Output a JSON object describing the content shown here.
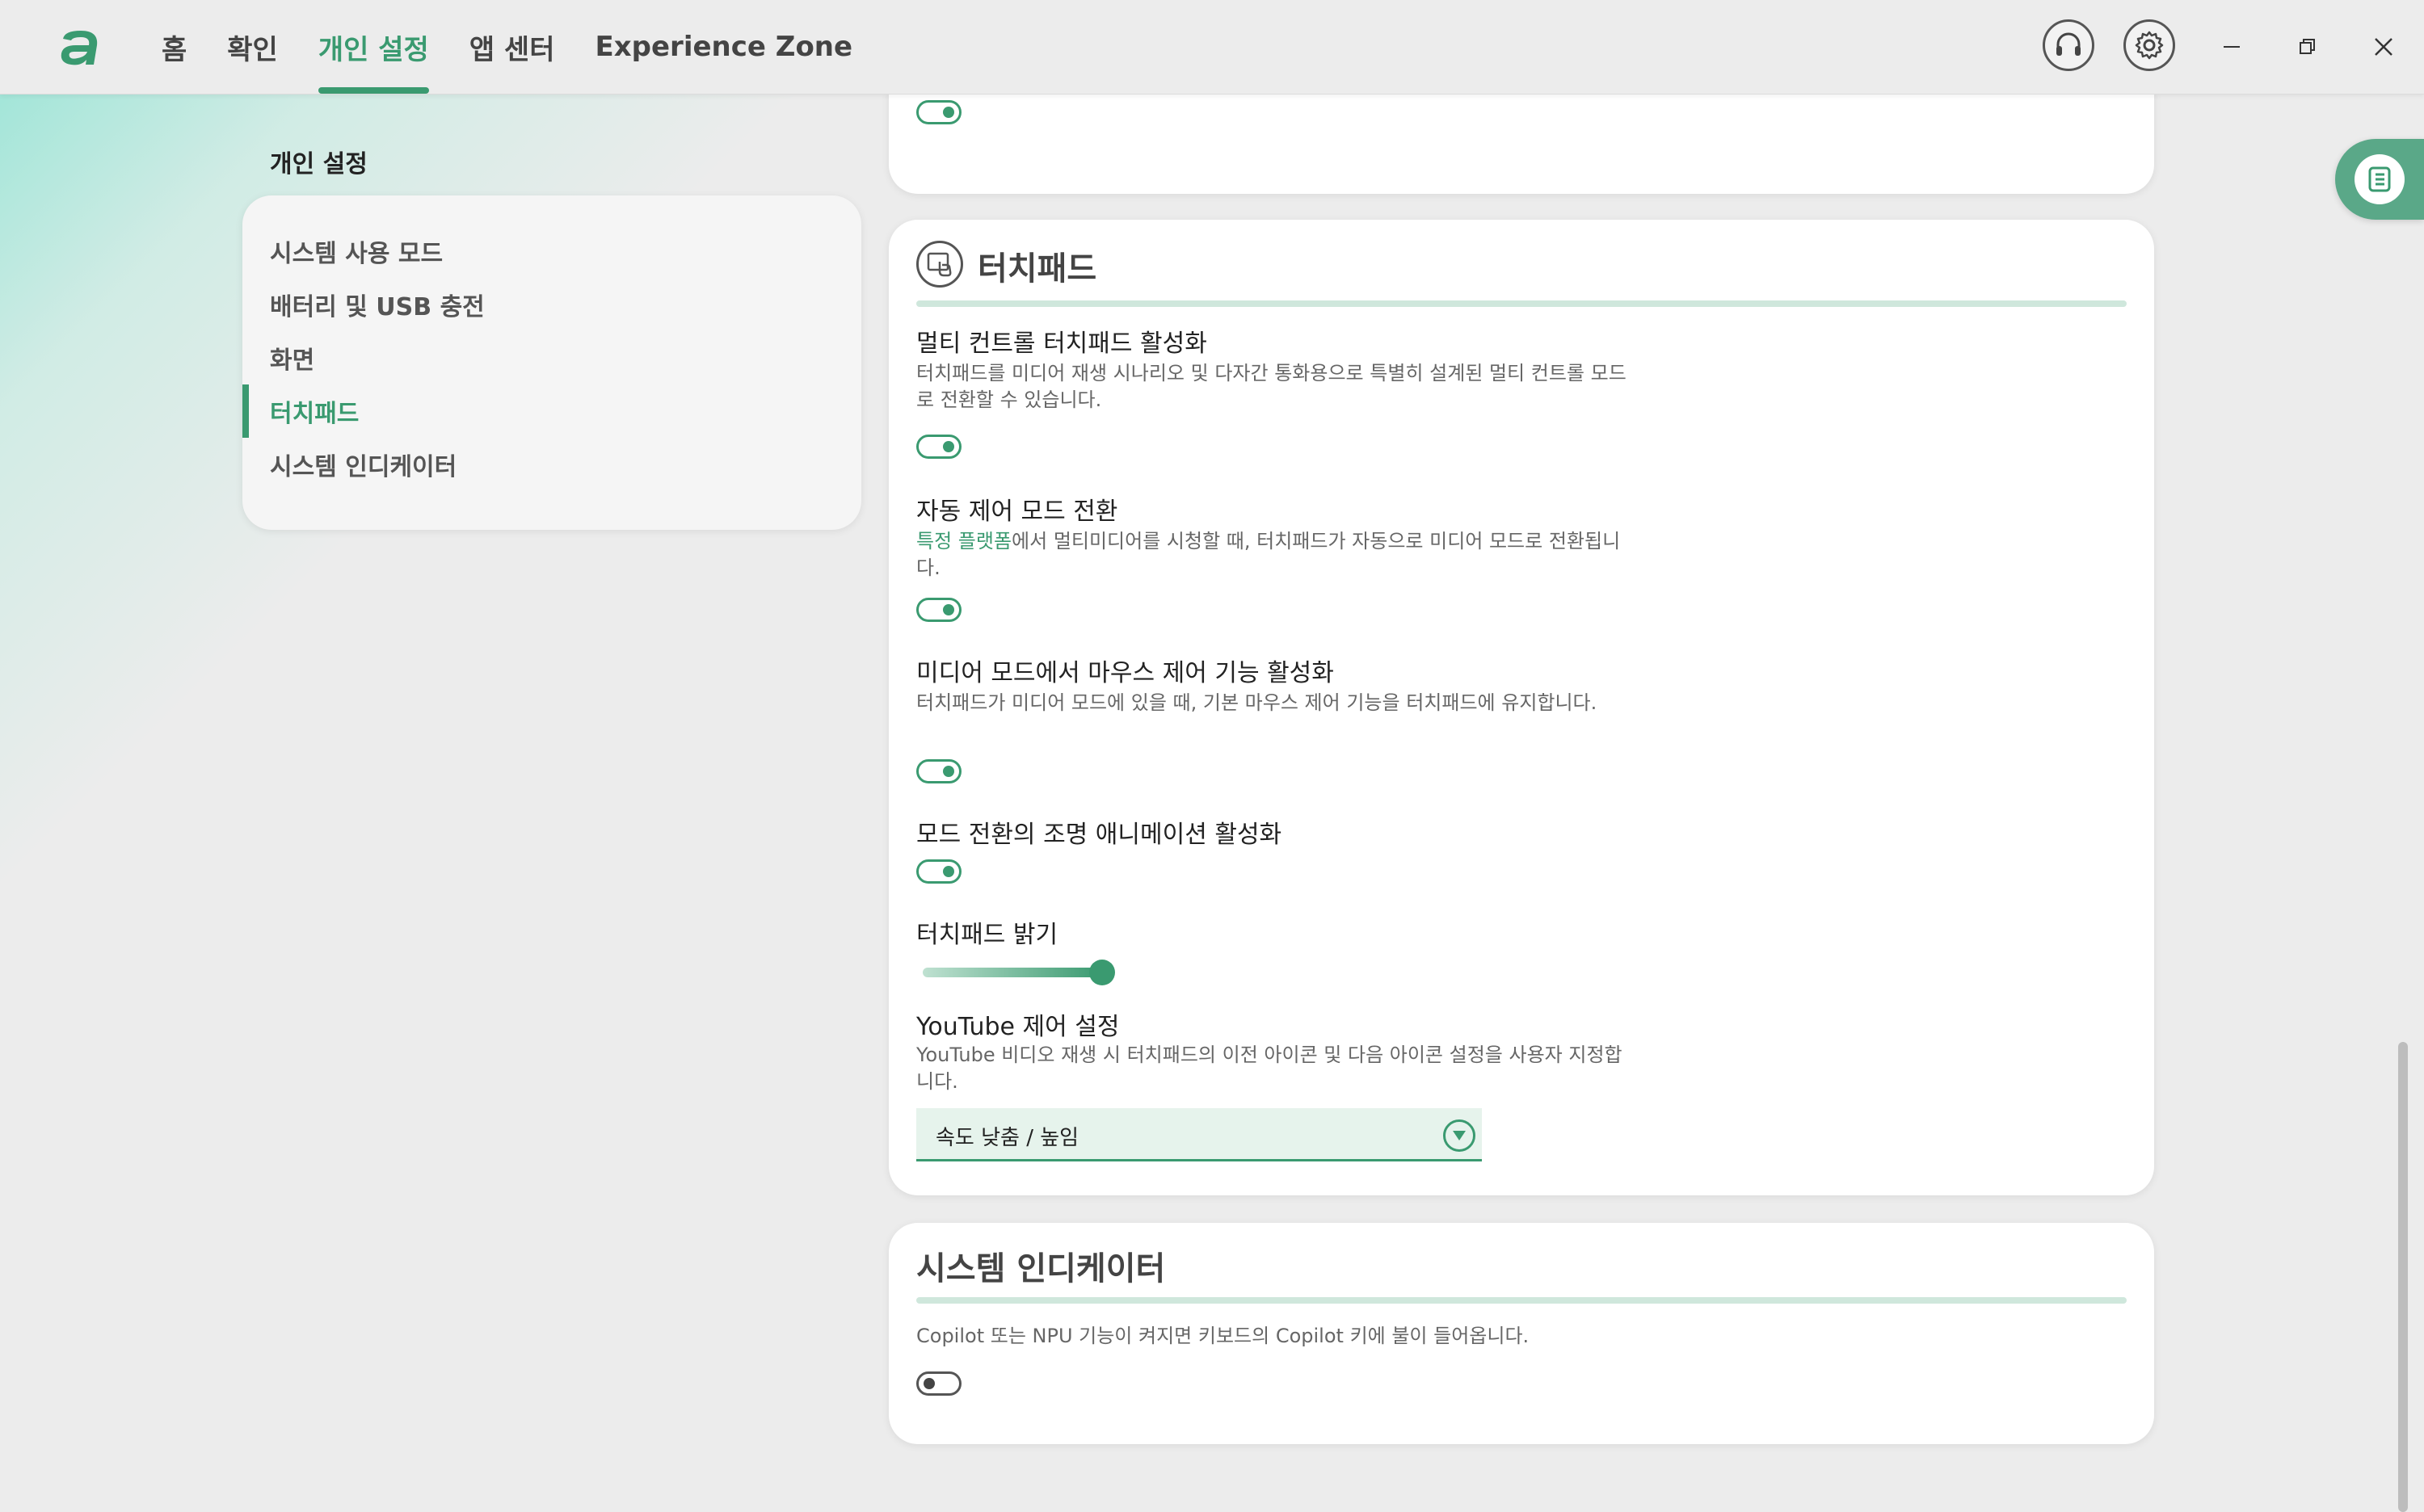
{
  "colors": {
    "accent": "#3a9a70",
    "accent_light": "#cfe7dc",
    "background": "#ececec"
  },
  "app": {
    "logo_icon": "acer-logo-icon"
  },
  "nav": {
    "tabs": [
      {
        "label": "홈"
      },
      {
        "label": "확인"
      },
      {
        "label": "개인 설정",
        "active": true
      },
      {
        "label": "앱 센터"
      },
      {
        "label": "Experience Zone"
      }
    ]
  },
  "header": {
    "support_icon": "headset-icon",
    "settings_icon": "gear-icon"
  },
  "window": {
    "minimize_icon": "minimize-icon",
    "restore_icon": "restore-icon",
    "close_icon": "close-icon"
  },
  "sidebar": {
    "title": "개인 설정",
    "items": [
      {
        "label": "시스템 사용 모드"
      },
      {
        "label": "배터리 및 USB 충전"
      },
      {
        "label": "화면"
      },
      {
        "label": "터치패드",
        "active": true
      },
      {
        "label": "시스템 인디케이터"
      }
    ]
  },
  "top_card": {
    "toggle_on": true
  },
  "touchpad": {
    "title": "터치패드",
    "icon": "touchpad-icon",
    "multi_control": {
      "title": "멀티 컨트롤 터치패드 활성화",
      "desc": "터치패드를 미디어 재생 시나리오 및 다자간 통화용으로 특별히 설계된 멀티 컨트롤 모드로 전환할 수 있습니다.",
      "enabled": true
    },
    "auto_switch": {
      "title": "자동 제어 모드 전환",
      "desc_link": "특정 플랫폼",
      "desc": "에서 멀티미디어를 시청할 때, 터치패드가 자동으로 미디어 모드로 전환됩니다.",
      "enabled": true
    },
    "mouse_control": {
      "title": "미디어 모드에서 마우스 제어 기능 활성화",
      "desc": "터치패드가 미디어 모드에 있을 때, 기본 마우스 제어 기능을 터치패드에 유지합니다.",
      "enabled": true
    },
    "lighting": {
      "title": "모드 전환의 조명 애니메이션 활성화",
      "enabled": true
    },
    "brightness": {
      "title": "터치패드 밝기",
      "level": 1.0
    },
    "youtube": {
      "title": "YouTube 제어 설정",
      "desc": "YouTube 비디오 재생 시 터치패드의 이전 아이콘 및 다음 아이콘 설정을 사용자 지정합니다.",
      "selected": "속도 낮춤 / 높임"
    }
  },
  "indicator": {
    "title": "시스템 인디케이터",
    "desc": "Copilot 또는 NPU 기능이 켜지면 키보드의 Copilot 키에 불이 들어옵니다.",
    "enabled": false
  },
  "side_panel": {
    "icon": "panel-list-icon"
  }
}
